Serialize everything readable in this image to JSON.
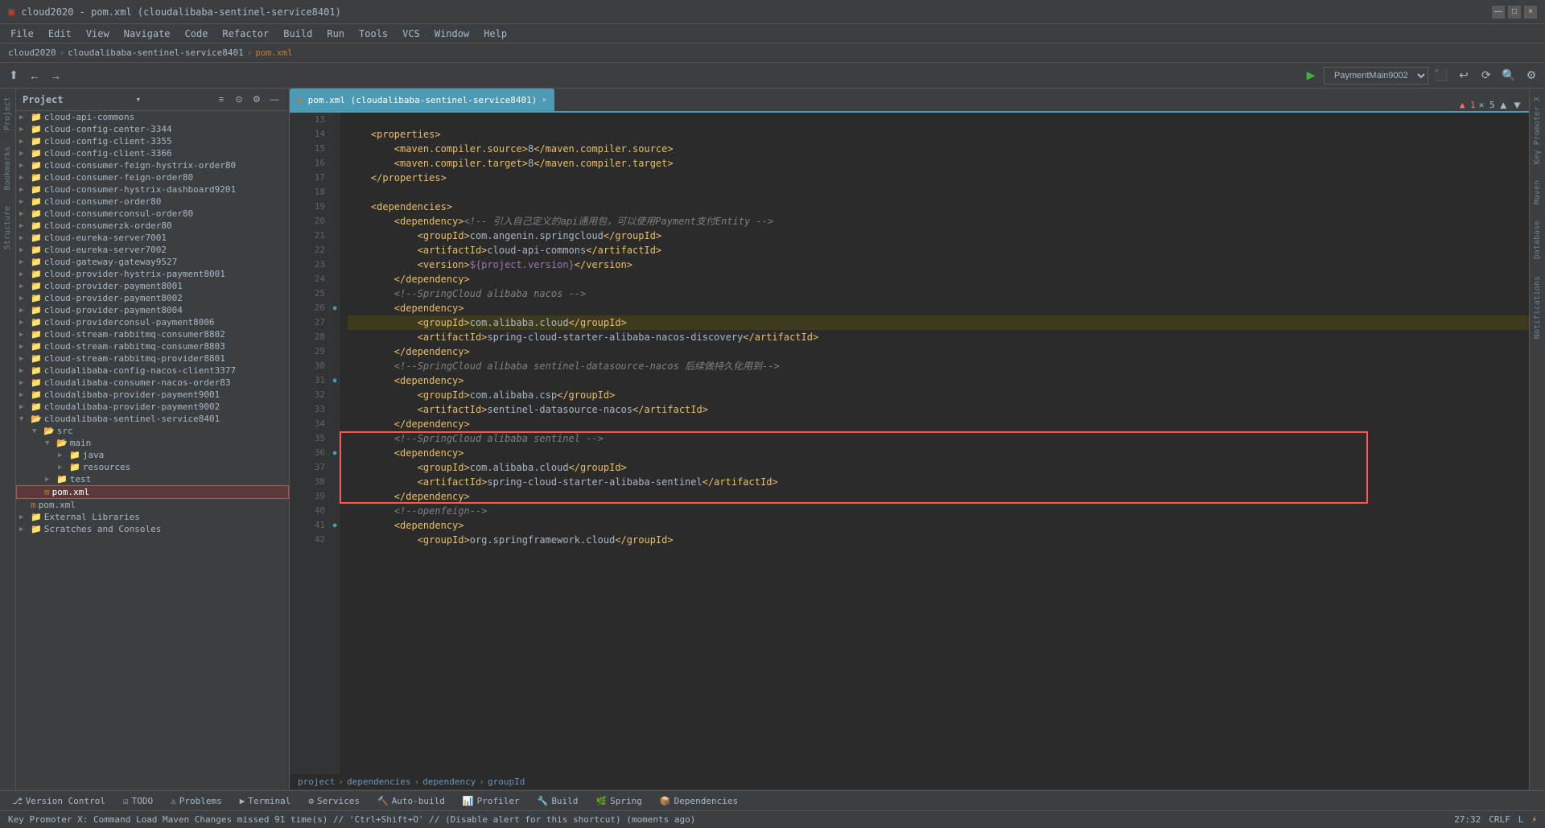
{
  "titleBar": {
    "title": "cloud2020 - pom.xml (cloudalibaba-sentinel-service8401)",
    "controls": [
      "—",
      "□",
      "×"
    ]
  },
  "menuBar": {
    "items": [
      "File",
      "Edit",
      "View",
      "Navigate",
      "Code",
      "Refactor",
      "Build",
      "Run",
      "Tools",
      "VCS",
      "Window",
      "Help"
    ]
  },
  "breadcrumb": {
    "items": [
      "cloud2020",
      "cloudalibaba-sentinel-service8401",
      "pom.xml"
    ]
  },
  "toolbar": {
    "runConfig": "PaymentMain9002",
    "buttons": [
      "←",
      "→",
      "▶",
      "⬛",
      "↩",
      "↪",
      "⟳",
      "⏹",
      "T",
      "🔍",
      "⚙",
      "⋮"
    ]
  },
  "projectPanel": {
    "title": "Project",
    "items": [
      {
        "label": "cloud-api-commons",
        "indent": 1,
        "type": "folder",
        "expanded": false
      },
      {
        "label": "cloud-config-center-3344",
        "indent": 1,
        "type": "folder",
        "expanded": false
      },
      {
        "label": "cloud-config-client-3355",
        "indent": 1,
        "type": "folder",
        "expanded": false
      },
      {
        "label": "cloud-config-client-3366",
        "indent": 1,
        "type": "folder",
        "expanded": false
      },
      {
        "label": "cloud-consumer-feign-hystrix-order80",
        "indent": 1,
        "type": "folder",
        "expanded": false
      },
      {
        "label": "cloud-consumer-feign-order80",
        "indent": 1,
        "type": "folder",
        "expanded": false
      },
      {
        "label": "cloud-consumer-hystrix-dashboard9201",
        "indent": 1,
        "type": "folder",
        "expanded": false
      },
      {
        "label": "cloud-consumer-order80",
        "indent": 1,
        "type": "folder",
        "expanded": false
      },
      {
        "label": "cloud-consumerconsul-order80",
        "indent": 1,
        "type": "folder",
        "expanded": false
      },
      {
        "label": "cloud-consumerzk-order80",
        "indent": 1,
        "type": "folder",
        "expanded": false
      },
      {
        "label": "cloud-eureka-server7001",
        "indent": 1,
        "type": "folder",
        "expanded": false
      },
      {
        "label": "cloud-eureka-server7002",
        "indent": 1,
        "type": "folder",
        "expanded": false
      },
      {
        "label": "cloud-gateway-gateway9527",
        "indent": 1,
        "type": "folder",
        "expanded": false
      },
      {
        "label": "cloud-provider-hystrix-payment8001",
        "indent": 1,
        "type": "folder",
        "expanded": false
      },
      {
        "label": "cloud-provider-payment8001",
        "indent": 1,
        "type": "folder",
        "expanded": false
      },
      {
        "label": "cloud-provider-payment8002",
        "indent": 1,
        "type": "folder",
        "expanded": false
      },
      {
        "label": "cloud-provider-payment8004",
        "indent": 1,
        "type": "folder",
        "expanded": false
      },
      {
        "label": "cloud-providerconsul-payment8006",
        "indent": 1,
        "type": "folder",
        "expanded": false
      },
      {
        "label": "cloud-stream-rabbitmq-consumer8802",
        "indent": 1,
        "type": "folder",
        "expanded": false
      },
      {
        "label": "cloud-stream-rabbitmq-consumer8803",
        "indent": 1,
        "type": "folder",
        "expanded": false
      },
      {
        "label": "cloud-stream-rabbitmq-provider8801",
        "indent": 1,
        "type": "folder",
        "expanded": false
      },
      {
        "label": "cloudalibaba-config-nacos-client3377",
        "indent": 1,
        "type": "folder",
        "expanded": false
      },
      {
        "label": "cloudalibaba-consumer-nacos-order83",
        "indent": 1,
        "type": "folder",
        "expanded": false
      },
      {
        "label": "cloudalibaba-provider-payment9001",
        "indent": 1,
        "type": "folder",
        "expanded": false
      },
      {
        "label": "cloudalibaba-provider-payment9002",
        "indent": 1,
        "type": "folder",
        "expanded": false
      },
      {
        "label": "cloudalibaba-sentinel-service8401",
        "indent": 1,
        "type": "folder",
        "expanded": true
      },
      {
        "label": "src",
        "indent": 2,
        "type": "folder",
        "expanded": true
      },
      {
        "label": "main",
        "indent": 3,
        "type": "folder",
        "expanded": true
      },
      {
        "label": "java",
        "indent": 4,
        "type": "folder",
        "expanded": false
      },
      {
        "label": "resources",
        "indent": 4,
        "type": "folder",
        "expanded": false
      },
      {
        "label": "test",
        "indent": 3,
        "type": "folder",
        "expanded": false
      },
      {
        "label": "pom.xml",
        "indent": 2,
        "type": "xml",
        "selected": true,
        "highlighted": true
      },
      {
        "label": "pom.xml",
        "indent": 1,
        "type": "xml"
      },
      {
        "label": "External Libraries",
        "indent": 1,
        "type": "folder",
        "expanded": false
      },
      {
        "label": "Scratches and Consoles",
        "indent": 1,
        "type": "folder",
        "expanded": false
      }
    ]
  },
  "editorTab": {
    "label": "pom.xml (cloudalibaba-sentinel-service8401)",
    "active": true
  },
  "codeLines": [
    {
      "num": 13,
      "content": "",
      "tokens": []
    },
    {
      "num": 14,
      "content": "    <properties>",
      "tokens": [
        {
          "text": "    ",
          "class": ""
        },
        {
          "text": "<properties>",
          "class": "xml-tag"
        }
      ]
    },
    {
      "num": 15,
      "content": "        <maven.compiler.source>8</maven.compiler.source>",
      "tokens": [
        {
          "text": "        ",
          "class": ""
        },
        {
          "text": "<maven.compiler.source>",
          "class": "xml-tag"
        },
        {
          "text": "8",
          "class": "xml-text"
        },
        {
          "text": "</maven.compiler.source>",
          "class": "xml-tag"
        }
      ]
    },
    {
      "num": 16,
      "content": "        <maven.compiler.target>8</maven.compiler.target>",
      "tokens": [
        {
          "text": "        ",
          "class": ""
        },
        {
          "text": "<maven.compiler.target>",
          "class": "xml-tag"
        },
        {
          "text": "8",
          "class": "xml-text"
        },
        {
          "text": "</maven.compiler.target>",
          "class": "xml-tag"
        }
      ]
    },
    {
      "num": 17,
      "content": "    </properties>",
      "tokens": [
        {
          "text": "    ",
          "class": ""
        },
        {
          "text": "</properties>",
          "class": "xml-tag"
        }
      ]
    },
    {
      "num": 18,
      "content": "",
      "tokens": []
    },
    {
      "num": 19,
      "content": "    <dependencies>",
      "tokens": [
        {
          "text": "    ",
          "class": ""
        },
        {
          "text": "<dependencies>",
          "class": "xml-tag"
        }
      ]
    },
    {
      "num": 20,
      "content": "        <dependency><!-- 引入自己定义的api通用包，可以使用Payment支付Entity -->",
      "tokens": [
        {
          "text": "        ",
          "class": ""
        },
        {
          "text": "<dependency>",
          "class": "xml-tag"
        },
        {
          "text": "<!-- 引入自己定义的api通用包，可以使用Payment支付Entity -->",
          "class": "xml-comment"
        }
      ]
    },
    {
      "num": 21,
      "content": "            <groupId>com.angenin.springcloud</groupId>",
      "tokens": [
        {
          "text": "            ",
          "class": ""
        },
        {
          "text": "<groupId>",
          "class": "xml-tag"
        },
        {
          "text": "com.angenin.springcloud",
          "class": "xml-text"
        },
        {
          "text": "</groupId>",
          "class": "xml-tag"
        }
      ]
    },
    {
      "num": 22,
      "content": "            <artifactId>cloud-api-commons</artifactId>",
      "tokens": [
        {
          "text": "            ",
          "class": ""
        },
        {
          "text": "<artifactId>",
          "class": "xml-tag"
        },
        {
          "text": "cloud-api-commons",
          "class": "xml-text"
        },
        {
          "text": "</artifactId>",
          "class": "xml-tag"
        }
      ]
    },
    {
      "num": 23,
      "content": "            <version>${project.version}</version>",
      "tokens": [
        {
          "text": "            ",
          "class": ""
        },
        {
          "text": "<version>",
          "class": "xml-tag"
        },
        {
          "text": "${project.version}",
          "class": "xml-special"
        },
        {
          "text": "</version>",
          "class": "xml-tag"
        }
      ]
    },
    {
      "num": 24,
      "content": "        </dependency>",
      "tokens": [
        {
          "text": "        ",
          "class": ""
        },
        {
          "text": "</dependency>",
          "class": "xml-tag"
        }
      ]
    },
    {
      "num": 25,
      "content": "        <!--SpringCloud alibaba nacos -->",
      "tokens": [
        {
          "text": "        ",
          "class": ""
        },
        {
          "text": "<!--SpringCloud ",
          "class": "xml-comment"
        },
        {
          "text": "alibaba nacos",
          "class": "xml-comment-tag"
        },
        {
          "text": " -->",
          "class": "xml-comment"
        }
      ]
    },
    {
      "num": 26,
      "content": "        <dependency>",
      "tokens": [
        {
          "text": "        ",
          "class": ""
        },
        {
          "text": "<dependency>",
          "class": "xml-tag"
        }
      ],
      "hasMarker": true
    },
    {
      "num": 27,
      "content": "            <groupId>com.alibaba.cloud</groupId>",
      "tokens": [
        {
          "text": "            ",
          "class": ""
        },
        {
          "text": "<groupId>",
          "class": "xml-tag"
        },
        {
          "text": "com.alibaba.cloud",
          "class": "xml-text"
        },
        {
          "text": "</groupId>",
          "class": "xml-tag"
        }
      ],
      "highlighted": true
    },
    {
      "num": 28,
      "content": "            <artifactId>spring-cloud-starter-alibaba-nacos-discovery</artifactId>",
      "tokens": [
        {
          "text": "            ",
          "class": ""
        },
        {
          "text": "<artifactId>",
          "class": "xml-tag"
        },
        {
          "text": "spring-cloud-starter-alibaba-nacos-discovery",
          "class": "xml-text"
        },
        {
          "text": "</artifactId>",
          "class": "xml-tag"
        }
      ]
    },
    {
      "num": 29,
      "content": "        </dependency>",
      "tokens": [
        {
          "text": "        ",
          "class": ""
        },
        {
          "text": "</dependency>",
          "class": "xml-tag"
        }
      ]
    },
    {
      "num": 30,
      "content": "        <!--SpringCloud alibaba sentinel-datasource-nacos 后续做持久化用到-->",
      "tokens": [
        {
          "text": "        ",
          "class": ""
        },
        {
          "text": "<!--SpringCloud ",
          "class": "xml-comment"
        },
        {
          "text": "alibaba sentinel-datasource-nacos",
          "class": "xml-comment-tag"
        },
        {
          "text": " 后续做持久化用到-->",
          "class": "xml-comment"
        }
      ]
    },
    {
      "num": 31,
      "content": "        <dependency>",
      "tokens": [
        {
          "text": "        ",
          "class": ""
        },
        {
          "text": "<dependency>",
          "class": "xml-tag"
        }
      ],
      "hasMarker": true
    },
    {
      "num": 32,
      "content": "            <groupId>com.alibaba.csp</groupId>",
      "tokens": [
        {
          "text": "            ",
          "class": ""
        },
        {
          "text": "<groupId>",
          "class": "xml-tag"
        },
        {
          "text": "com.alibaba.csp",
          "class": "xml-text"
        },
        {
          "text": "</groupId>",
          "class": "xml-tag"
        }
      ]
    },
    {
      "num": 33,
      "content": "            <artifactId>sentinel-datasource-nacos</artifactId>",
      "tokens": [
        {
          "text": "            ",
          "class": ""
        },
        {
          "text": "<artifactId>",
          "class": "xml-tag"
        },
        {
          "text": "sentinel-datasource-nacos",
          "class": "xml-text"
        },
        {
          "text": "</artifactId>",
          "class": "xml-tag"
        }
      ]
    },
    {
      "num": 34,
      "content": "        </dependency>",
      "tokens": [
        {
          "text": "        ",
          "class": ""
        },
        {
          "text": "</dependency>",
          "class": "xml-tag"
        }
      ]
    },
    {
      "num": 35,
      "content": "        <!--SpringCloud alibaba sentinel -->",
      "tokens": [
        {
          "text": "        ",
          "class": ""
        },
        {
          "text": "<!--SpringCloud ",
          "class": "xml-comment"
        },
        {
          "text": "alibaba sentinel",
          "class": "xml-comment-tag"
        },
        {
          "text": " -->",
          "class": "xml-comment"
        }
      ],
      "redBox": true
    },
    {
      "num": 36,
      "content": "        <dependency>",
      "tokens": [
        {
          "text": "        ",
          "class": ""
        },
        {
          "text": "<dependency>",
          "class": "xml-tag"
        }
      ],
      "redBox": true,
      "hasMarker": true
    },
    {
      "num": 37,
      "content": "            <groupId>com.alibaba.cloud</groupId>",
      "tokens": [
        {
          "text": "            ",
          "class": ""
        },
        {
          "text": "<groupId>",
          "class": "xml-tag"
        },
        {
          "text": "com.alibaba.cloud",
          "class": "xml-text"
        },
        {
          "text": "</groupId>",
          "class": "xml-tag"
        }
      ],
      "redBox": true
    },
    {
      "num": 38,
      "content": "            <artifactId>spring-cloud-starter-alibaba-sentinel</artifactId>",
      "tokens": [
        {
          "text": "            ",
          "class": ""
        },
        {
          "text": "<artifactId>",
          "class": "xml-tag"
        },
        {
          "text": "spring-cloud-starter-alibaba-sentinel",
          "class": "xml-text"
        },
        {
          "text": "</artifactId>",
          "class": "xml-tag"
        }
      ],
      "redBox": true
    },
    {
      "num": 39,
      "content": "        </dependency>",
      "tokens": [
        {
          "text": "        ",
          "class": ""
        },
        {
          "text": "</dependency>",
          "class": "xml-tag"
        }
      ],
      "redBox": true
    },
    {
      "num": 40,
      "content": "        <!--openfeign-->",
      "tokens": [
        {
          "text": "        ",
          "class": ""
        },
        {
          "text": "<!--openfeign-->",
          "class": "xml-comment"
        }
      ]
    },
    {
      "num": 41,
      "content": "        <dependency>",
      "tokens": [
        {
          "text": "        ",
          "class": ""
        },
        {
          "text": "<dependency>",
          "class": "xml-tag"
        }
      ],
      "hasMarker": true
    },
    {
      "num": 42,
      "content": "            <groupId>org.springframework.cloud</groupId>",
      "tokens": [
        {
          "text": "            ",
          "class": ""
        },
        {
          "text": "<groupId>",
          "class": "xml-tag"
        },
        {
          "text": "org.springframework.cloud",
          "class": "xml-text"
        },
        {
          "text": "</groupId>",
          "class": "xml-tag"
        }
      ]
    }
  ],
  "bottomBreadcrumb": {
    "items": [
      "project",
      "dependencies",
      "dependency",
      "groupId"
    ]
  },
  "bottomTabs": [
    {
      "label": "Version Control",
      "icon": "⎇",
      "active": false
    },
    {
      "label": "TODO",
      "icon": "☑",
      "active": false
    },
    {
      "label": "Problems",
      "icon": "⚠",
      "active": false
    },
    {
      "label": "Terminal",
      "icon": ">_",
      "active": false
    },
    {
      "label": "Services",
      "icon": "⚙",
      "active": false
    },
    {
      "label": "Auto-build",
      "icon": "🔨",
      "active": false
    },
    {
      "label": "Profiler",
      "icon": "📊",
      "active": false
    },
    {
      "label": "Build",
      "icon": "🔧",
      "active": false
    },
    {
      "label": "Spring",
      "icon": "🌿",
      "active": false
    },
    {
      "label": "Dependencies",
      "icon": "📦",
      "active": false
    }
  ],
  "statusBar": {
    "message": "Key Promoter X: Command Load Maven Changes missed 91 time(s) // 'Ctrl+Shift+O' // (Disable alert for this shortcut) (moments ago)",
    "position": "27:32",
    "encoding": "L",
    "lineEnding": "CRLF"
  }
}
